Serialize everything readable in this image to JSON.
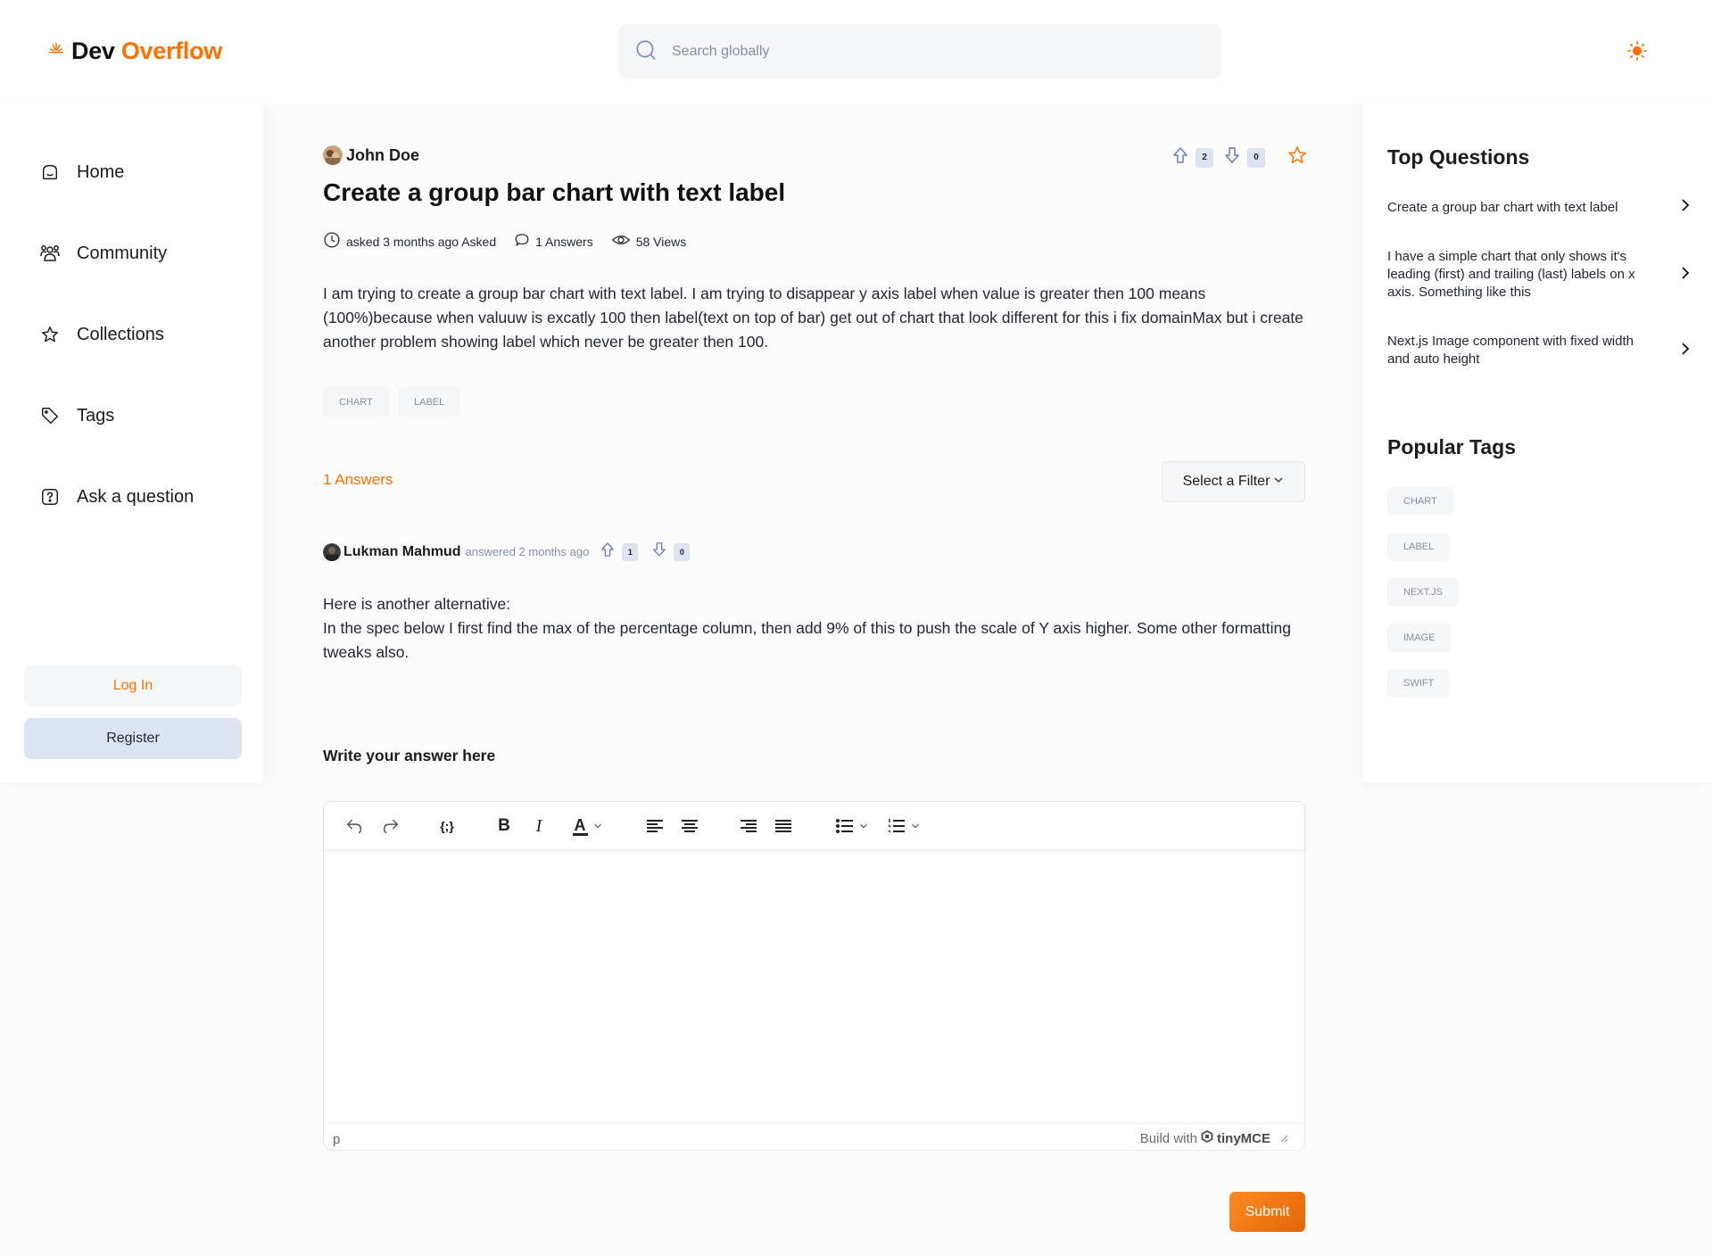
{
  "logo": {
    "part1": "Dev ",
    "part2": "Overflow"
  },
  "search": {
    "placeholder": "Search globally"
  },
  "sidebar": {
    "items": [
      {
        "label": "Home",
        "icon": "home-icon"
      },
      {
        "label": "Community",
        "icon": "users-icon"
      },
      {
        "label": "Collections",
        "icon": "star-icon"
      },
      {
        "label": "Tags",
        "icon": "tag-icon"
      },
      {
        "label": "Ask a question",
        "icon": "question-icon"
      }
    ],
    "login_label": "Log In",
    "register_label": "Register"
  },
  "question": {
    "author": "John Doe",
    "upvotes": "2",
    "downvotes": "0",
    "title": "Create a group bar chart with text label",
    "asked": "asked 3 months ago Asked",
    "answers": "1 Answers",
    "views": "58 Views",
    "body": "I am trying to create a group bar chart with text label. I am trying to disappear y axis label when value is greater then 100 means (100%)because when valuuw is excatly 100 then label(text on top of bar) get out of chart that look different for this i fix domainMax but i create another problem showing label which never be greater then 100.",
    "tags": [
      "CHART",
      "LABEL"
    ]
  },
  "answers_section": {
    "count_label": "1 Answers",
    "filter_label": "Select a Filter"
  },
  "answer": {
    "author": "Lukman Mahmud",
    "time": "answered 2 months ago",
    "upvotes": "1",
    "downvotes": "0",
    "line1": "Here is another alternative:",
    "line2": "In the spec below I first find the max of the percentage column, then add 9% of this to push the scale of Y axis higher. Some other formatting tweaks also."
  },
  "editor": {
    "label": "Write your answer here",
    "status_path": "p",
    "build_with": "Build with",
    "brand": "tinyMCE"
  },
  "submit_label": "Submit",
  "right_sidebar": {
    "top_title": "Top Questions",
    "top_questions": [
      "Create a group bar chart with text label",
      "I have a simple chart that only shows it's leading (first) and trailing (last) labels on x axis. Something like this",
      "Next.js Image component with fixed width and auto height"
    ],
    "tags_title": "Popular Tags",
    "popular_tags": [
      "CHART",
      "LABEL",
      "NEXT.JS",
      "IMAGE",
      "SWIFT"
    ]
  },
  "colors": {
    "accent": "#ff7000",
    "badge": "#dce3f1",
    "surface": "#f4f6f8"
  }
}
